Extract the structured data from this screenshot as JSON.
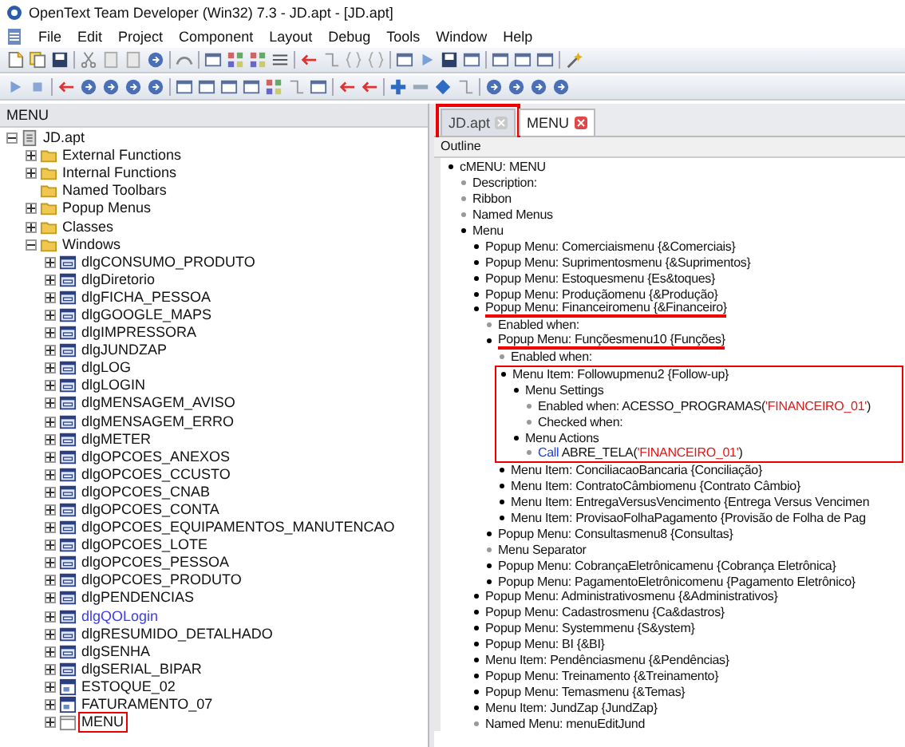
{
  "window": {
    "title": "OpenText Team Developer (Win32) 7.3 - JD.apt - [JD.apt]"
  },
  "menu_bar": [
    "File",
    "Edit",
    "Project",
    "Component",
    "Layout",
    "Debug",
    "Tools",
    "Window",
    "Help"
  ],
  "left_panel": {
    "title": "MENU",
    "tree": [
      {
        "label": "JD.apt",
        "kind": "app",
        "expandable": true,
        "expanded": true,
        "children": [
          {
            "label": "External Functions",
            "kind": "folder",
            "expandable": true,
            "expanded": false
          },
          {
            "label": "Internal Functions",
            "kind": "folder",
            "expandable": true,
            "expanded": false
          },
          {
            "label": "Named Toolbars",
            "kind": "folder",
            "expandable": false
          },
          {
            "label": "Popup Menus",
            "kind": "folder",
            "expandable": true,
            "expanded": false
          },
          {
            "label": "Classes",
            "kind": "folder",
            "expandable": true,
            "expanded": false
          },
          {
            "label": "Windows",
            "kind": "folder",
            "expandable": true,
            "expanded": true,
            "children": [
              {
                "label": "dlgCONSUMO_PRODUTO",
                "kind": "dialog",
                "expandable": true,
                "expanded": false
              },
              {
                "label": "dlgDiretorio",
                "kind": "dialog",
                "expandable": true,
                "expanded": false
              },
              {
                "label": "dlgFICHA_PESSOA",
                "kind": "dialog",
                "expandable": true,
                "expanded": false
              },
              {
                "label": "dlgGOOGLE_MAPS",
                "kind": "dialog",
                "expandable": true,
                "expanded": false
              },
              {
                "label": "dlgIMPRESSORA",
                "kind": "dialog",
                "expandable": true,
                "expanded": false
              },
              {
                "label": "dlgJUNDZAP",
                "kind": "dialog",
                "expandable": true,
                "expanded": false
              },
              {
                "label": "dlgLOG",
                "kind": "dialog",
                "expandable": true,
                "expanded": false
              },
              {
                "label": "dlgLOGIN",
                "kind": "dialog",
                "expandable": true,
                "expanded": false
              },
              {
                "label": "dlgMENSAGEM_AVISO",
                "kind": "dialog",
                "expandable": true,
                "expanded": false
              },
              {
                "label": "dlgMENSAGEM_ERRO",
                "kind": "dialog",
                "expandable": true,
                "expanded": false
              },
              {
                "label": "dlgMETER",
                "kind": "dialog",
                "expandable": true,
                "expanded": false
              },
              {
                "label": "dlgOPCOES_ANEXOS",
                "kind": "dialog",
                "expandable": true,
                "expanded": false
              },
              {
                "label": "dlgOPCOES_CCUSTO",
                "kind": "dialog",
                "expandable": true,
                "expanded": false
              },
              {
                "label": "dlgOPCOES_CNAB",
                "kind": "dialog",
                "expandable": true,
                "expanded": false
              },
              {
                "label": "dlgOPCOES_CONTA",
                "kind": "dialog",
                "expandable": true,
                "expanded": false
              },
              {
                "label": "dlgOPCOES_EQUIPAMENTOS_MANUTENCAO",
                "kind": "dialog",
                "expandable": true,
                "expanded": false
              },
              {
                "label": "dlgOPCOES_LOTE",
                "kind": "dialog",
                "expandable": true,
                "expanded": false
              },
              {
                "label": "dlgOPCOES_PESSOA",
                "kind": "dialog",
                "expandable": true,
                "expanded": false
              },
              {
                "label": "dlgOPCOES_PRODUTO",
                "kind": "dialog",
                "expandable": true,
                "expanded": false
              },
              {
                "label": "dlgPENDENCIAS",
                "kind": "dialog",
                "expandable": true,
                "expanded": false
              },
              {
                "label": "dlgQOLogin",
                "kind": "dialog",
                "expandable": true,
                "expanded": false,
                "color": "#3c3cf0"
              },
              {
                "label": "dlgRESUMIDO_DETALHADO",
                "kind": "dialog",
                "expandable": true,
                "expanded": false
              },
              {
                "label": "dlgSENHA",
                "kind": "dialog",
                "expandable": true,
                "expanded": false
              },
              {
                "label": "dlgSERIAL_BIPAR",
                "kind": "dialog",
                "expandable": true,
                "expanded": false
              },
              {
                "label": "ESTOQUE_02",
                "kind": "form",
                "expandable": true,
                "expanded": false
              },
              {
                "label": "FATURAMENTO_07",
                "kind": "form",
                "expandable": true,
                "expanded": false
              },
              {
                "label": "MENU",
                "kind": "window",
                "expandable": true,
                "expanded": false,
                "boxed": true
              }
            ]
          }
        ]
      }
    ]
  },
  "tabs": [
    {
      "label": "JD.apt",
      "selected": false,
      "boxed": true
    },
    {
      "label": "MENU",
      "selected": true
    }
  ],
  "outline": {
    "title": "Outline",
    "items": [
      {
        "text": "cMENU: MENU",
        "kind": "group",
        "children": [
          {
            "text": "Description:",
            "kind": "property"
          },
          {
            "text": "Ribbon",
            "kind": "property"
          },
          {
            "text": "Named Menus",
            "kind": "property"
          },
          {
            "text": "Menu",
            "kind": "group",
            "children": [
              {
                "text": "Popup Menu: Comerciaismenu {&Comerciais}",
                "kind": "group"
              },
              {
                "text": "Popup Menu: Suprimentosmenu {&Suprimentos}",
                "kind": "group"
              },
              {
                "text": "Popup Menu: Estoquesmenu {Es&toques}",
                "kind": "group"
              },
              {
                "text": "Popup Menu: Produçãomenu {&Produção}",
                "kind": "group"
              },
              {
                "text": "Popup Menu: Financeiromenu {&Financeiro}",
                "kind": "group",
                "underlined": true,
                "children": [
                  {
                    "text": "Enabled when:",
                    "kind": "property"
                  },
                  {
                    "text": "Popup Menu: Funçõesmenu10 {Funções}",
                    "kind": "group",
                    "underlined": true,
                    "children": [
                      {
                        "text": "Enabled when:",
                        "kind": "property"
                      },
                      {
                        "text": "Menu Item: Followupmenu2 {Follow-up}",
                        "kind": "group",
                        "boxed": true,
                        "children": [
                          {
                            "text": "Menu Settings",
                            "kind": "group",
                            "children": [
                              {
                                "parts": [
                                  {
                                    "text": "Enabled when: ACESSO_PROGRAMAS(",
                                    "kind": "plain"
                                  },
                                  {
                                    "text": "'FINANCEIRO_01'",
                                    "kind": "string"
                                  },
                                  {
                                    "text": ")",
                                    "kind": "plain"
                                  }
                                ],
                                "kind": "property"
                              },
                              {
                                "text": "Checked when:",
                                "kind": "property"
                              }
                            ]
                          },
                          {
                            "text": "Menu Actions",
                            "kind": "group",
                            "children": [
                              {
                                "parts": [
                                  {
                                    "text": "Call",
                                    "kind": "keyword"
                                  },
                                  {
                                    "text": " ABRE_TELA(",
                                    "kind": "plain"
                                  },
                                  {
                                    "text": "'FINANCEIRO_01'",
                                    "kind": "string"
                                  },
                                  {
                                    "text": ")",
                                    "kind": "plain"
                                  }
                                ],
                                "kind": "property"
                              }
                            ]
                          }
                        ]
                      },
                      {
                        "text": "Menu Item: ConciliacaoBancaria {Conciliação}",
                        "kind": "group"
                      },
                      {
                        "text": "Menu Item: ContratoCâmbiomenu {Contrato Câmbio}",
                        "kind": "group"
                      },
                      {
                        "text": "Menu Item: EntregaVersusVencimento {Entrega Versus Vencimen",
                        "kind": "group"
                      },
                      {
                        "text": "Menu Item: ProvisaoFolhaPagamento {Provisão de Folha de Pag",
                        "kind": "group"
                      }
                    ]
                  },
                  {
                    "text": "Popup Menu: Consultasmenu8 {Consultas}",
                    "kind": "group"
                  },
                  {
                    "text": "Menu Separator",
                    "kind": "property"
                  },
                  {
                    "text": "Popup Menu: CobrançaEletrônicamenu {Cobrança Eletrônica}",
                    "kind": "group"
                  },
                  {
                    "text": "Popup Menu: PagamentoEletrônicomenu {Pagamento Eletrônico}",
                    "kind": "group"
                  }
                ]
              },
              {
                "text": "Popup Menu: Administrativosmenu {&Administrativos}",
                "kind": "group"
              },
              {
                "text": "Popup Menu: Cadastrosmenu {Ca&dastros}",
                "kind": "group"
              },
              {
                "text": "Popup Menu: Systemmenu {S&ystem}",
                "kind": "group"
              },
              {
                "text": "Popup Menu: BI {&BI}",
                "kind": "group"
              },
              {
                "text": "Menu Item: Pendênciasmenu {&Pendências}",
                "kind": "group"
              },
              {
                "text": "Popup Menu: Treinamento {&Treinamento}",
                "kind": "group"
              },
              {
                "text": "Popup Menu: Temasmenu {&Temas}",
                "kind": "group"
              },
              {
                "text": "Menu Item: JundZap {JundZap}",
                "kind": "group"
              },
              {
                "text": "Named Menu: menuEditJund",
                "kind": "property"
              }
            ]
          }
        ]
      }
    ]
  }
}
